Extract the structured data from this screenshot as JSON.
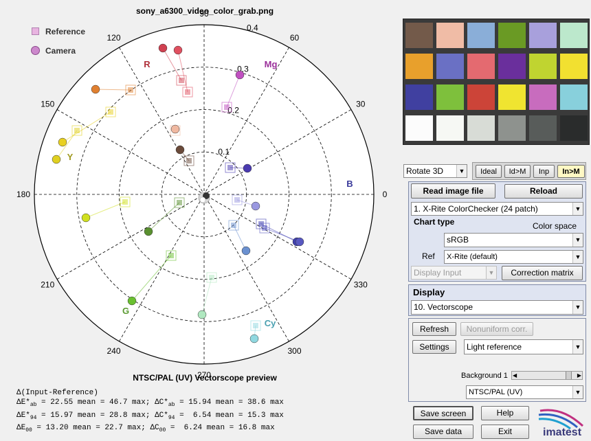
{
  "window": {
    "filename": "sony_a6300_video_color_grab.png"
  },
  "legend": {
    "reference": "Reference",
    "camera": "Camera"
  },
  "colors": {
    "reference_legend": "#e8b4e0",
    "camera_legend": "#cc88cc",
    "patches": [
      "#735244",
      "#c29682",
      "#627a9d",
      "#576c43",
      "#8580b1",
      "#67bdaa",
      "#d67e2c",
      "#505ba6",
      "#c15a63",
      "#5e3c6c",
      "#9dbc40",
      "#e0a32e",
      "#383d96",
      "#469449",
      "#af363c",
      "#e7c71f",
      "#bb5695",
      "#0885a1",
      "#f3f3f2",
      "#c8c8c8",
      "#a0a0a0",
      "#7a7a79",
      "#555555",
      "#343434"
    ],
    "screen_patches": [
      "#735a4a",
      "#f0bca6",
      "#8aaed8",
      "#6a9a24",
      "#a8a0dc",
      "#bce8cc",
      "#e8a02c",
      "#6a70c4",
      "#e46a70",
      "#6a2f9c",
      "#c0d430",
      "#f2e030",
      "#4040a0",
      "#7ec03c",
      "#cc4438",
      "#f0e430",
      "#c86cbe",
      "#88d0dc",
      "#fcfcfc",
      "#f6f8f4",
      "#d8dcd6",
      "#8e928e",
      "#585c5a",
      "#2a2c2c"
    ]
  },
  "vectorscope": {
    "title": "NTSC/PAL (UV) Vectorscope preview",
    "angle_labels": [
      "0",
      "30",
      "60",
      "90",
      "120",
      "150",
      "180",
      "210",
      "240",
      "270",
      "300",
      "330"
    ],
    "radius_labels": [
      "0.1",
      "0.2",
      "0.3",
      "0.4"
    ],
    "hue_labels": {
      "r": "R",
      "mg": "Mg",
      "b": "B",
      "cy": "Cy",
      "g": "G",
      "y": "Y"
    }
  },
  "stats": {
    "header": "Δ(Input-Reference)",
    "row1": {
      "a": "ΔE*",
      "a_sub": "ab",
      "a_val": " = 22.55 mean = 46.7 max; ",
      "b": "ΔC*",
      "b_sub": "ab",
      "b_val": " = 15.94 mean = 38.6 max"
    },
    "row2": {
      "a": "ΔE*",
      "a_sub": "94",
      "a_val": " = 15.97 mean = 28.8 max; ",
      "b": "ΔC*",
      "b_sub": "94",
      "b_val": " =  6.54 mean = 15.3 max"
    },
    "row3": {
      "a": "ΔE",
      "a_sub": "00",
      "a_val": " = 13.20 mean = 22.7 max; ",
      "b": "ΔC",
      "b_sub": "00",
      "b_val": " =  6.24 mean = 16.8 max"
    }
  },
  "controls": {
    "rotate_select": "Rotate 3D",
    "view_buttons": [
      "Ideal",
      "Id>M",
      "Inp",
      "In>M"
    ],
    "read_image": "Read image file",
    "reload": "Reload",
    "chart_select": "1. X-Rite ColorChecker (24 patch)",
    "chart_type": "Chart type",
    "color_space": "Color space",
    "color_space_select": "sRGB",
    "ref_label": "Ref",
    "ref_select": "X-Rite (default)",
    "display_input_select": "Display Input",
    "correction_matrix": "Correction matrix",
    "display_heading": "Display",
    "display_select": "10. Vectorscope",
    "refresh": "Refresh",
    "nonuniform": "Nonuniform corr.",
    "settings": "Settings",
    "light_reference_select": "Light reference",
    "background_label": "Background 1",
    "ntsc_select": "NTSC/PAL (UV)",
    "save_screen": "Save screen",
    "help": "Help",
    "save_data": "Save data",
    "exit": "Exit",
    "logo": "imatest"
  }
}
